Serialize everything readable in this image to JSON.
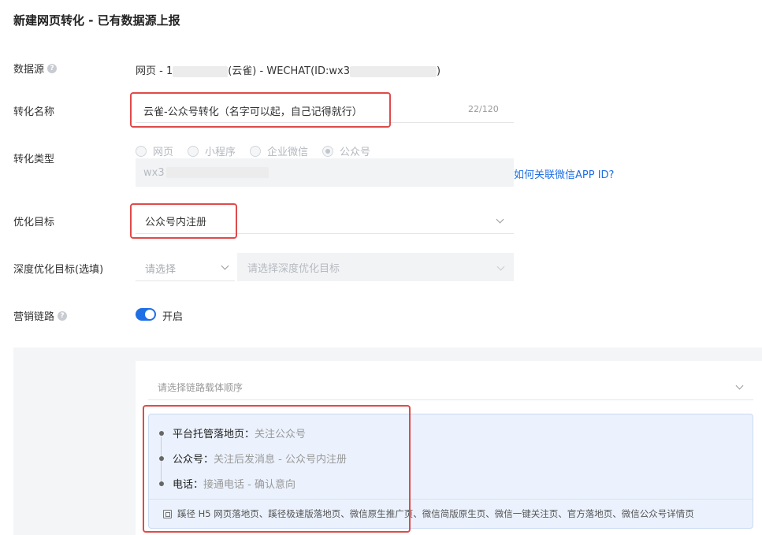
{
  "page": {
    "title": "新建网页转化 - 已有数据源上报"
  },
  "fields": {
    "datasource": {
      "label": "数据源",
      "help_icon": "question-circle-icon",
      "value_prefix": "网页 - 1",
      "value_mid": "(云雀) - WECHAT(ID:wx3",
      "value_suffix": ")"
    },
    "conversion_name": {
      "label": "转化名称",
      "value": "云雀-公众号转化（名字可以起，自己记得就行）",
      "counter": "22/120"
    },
    "conversion_type": {
      "label": "转化类型",
      "options": [
        "网页",
        "小程序",
        "企业微信",
        "公众号"
      ],
      "selected": "公众号",
      "app_id_value": "wx3",
      "link": "如何关联微信APP ID?"
    },
    "optimize_goal": {
      "label": "优化目标",
      "value": "公众号内注册"
    },
    "deep_goal": {
      "label": "深度优化目标(选填)",
      "select1_placeholder": "请选择",
      "select2_placeholder": "请选择深度优化目标"
    },
    "marketing_chain": {
      "label": "营销链路",
      "help_icon": "question-circle-icon",
      "toggle_label": "开启",
      "enabled": true
    }
  },
  "chain_panel": {
    "select_placeholder": "请选择链路载体顺序",
    "items": [
      {
        "key": "平台托管落地页",
        "sep": "：",
        "value": "关注公众号"
      },
      {
        "key": "公众号",
        "sep": "：",
        "value": "关注后发消息 - 公众号内注册"
      },
      {
        "key": "电话",
        "sep": "：",
        "value": "接通电话 - 确认意向"
      }
    ],
    "footer_icon": "page-icon",
    "footer_text": "蹊径 H5 网页落地页、蹊径极速版落地页、微信原生推广页、微信简版原生页、微信一键关注页、官方落地页、微信公众号详情页"
  },
  "colors": {
    "accent": "#1f6fe5",
    "highlight_box": "#e04a4a",
    "chain_bg": "#ebf2fd"
  }
}
